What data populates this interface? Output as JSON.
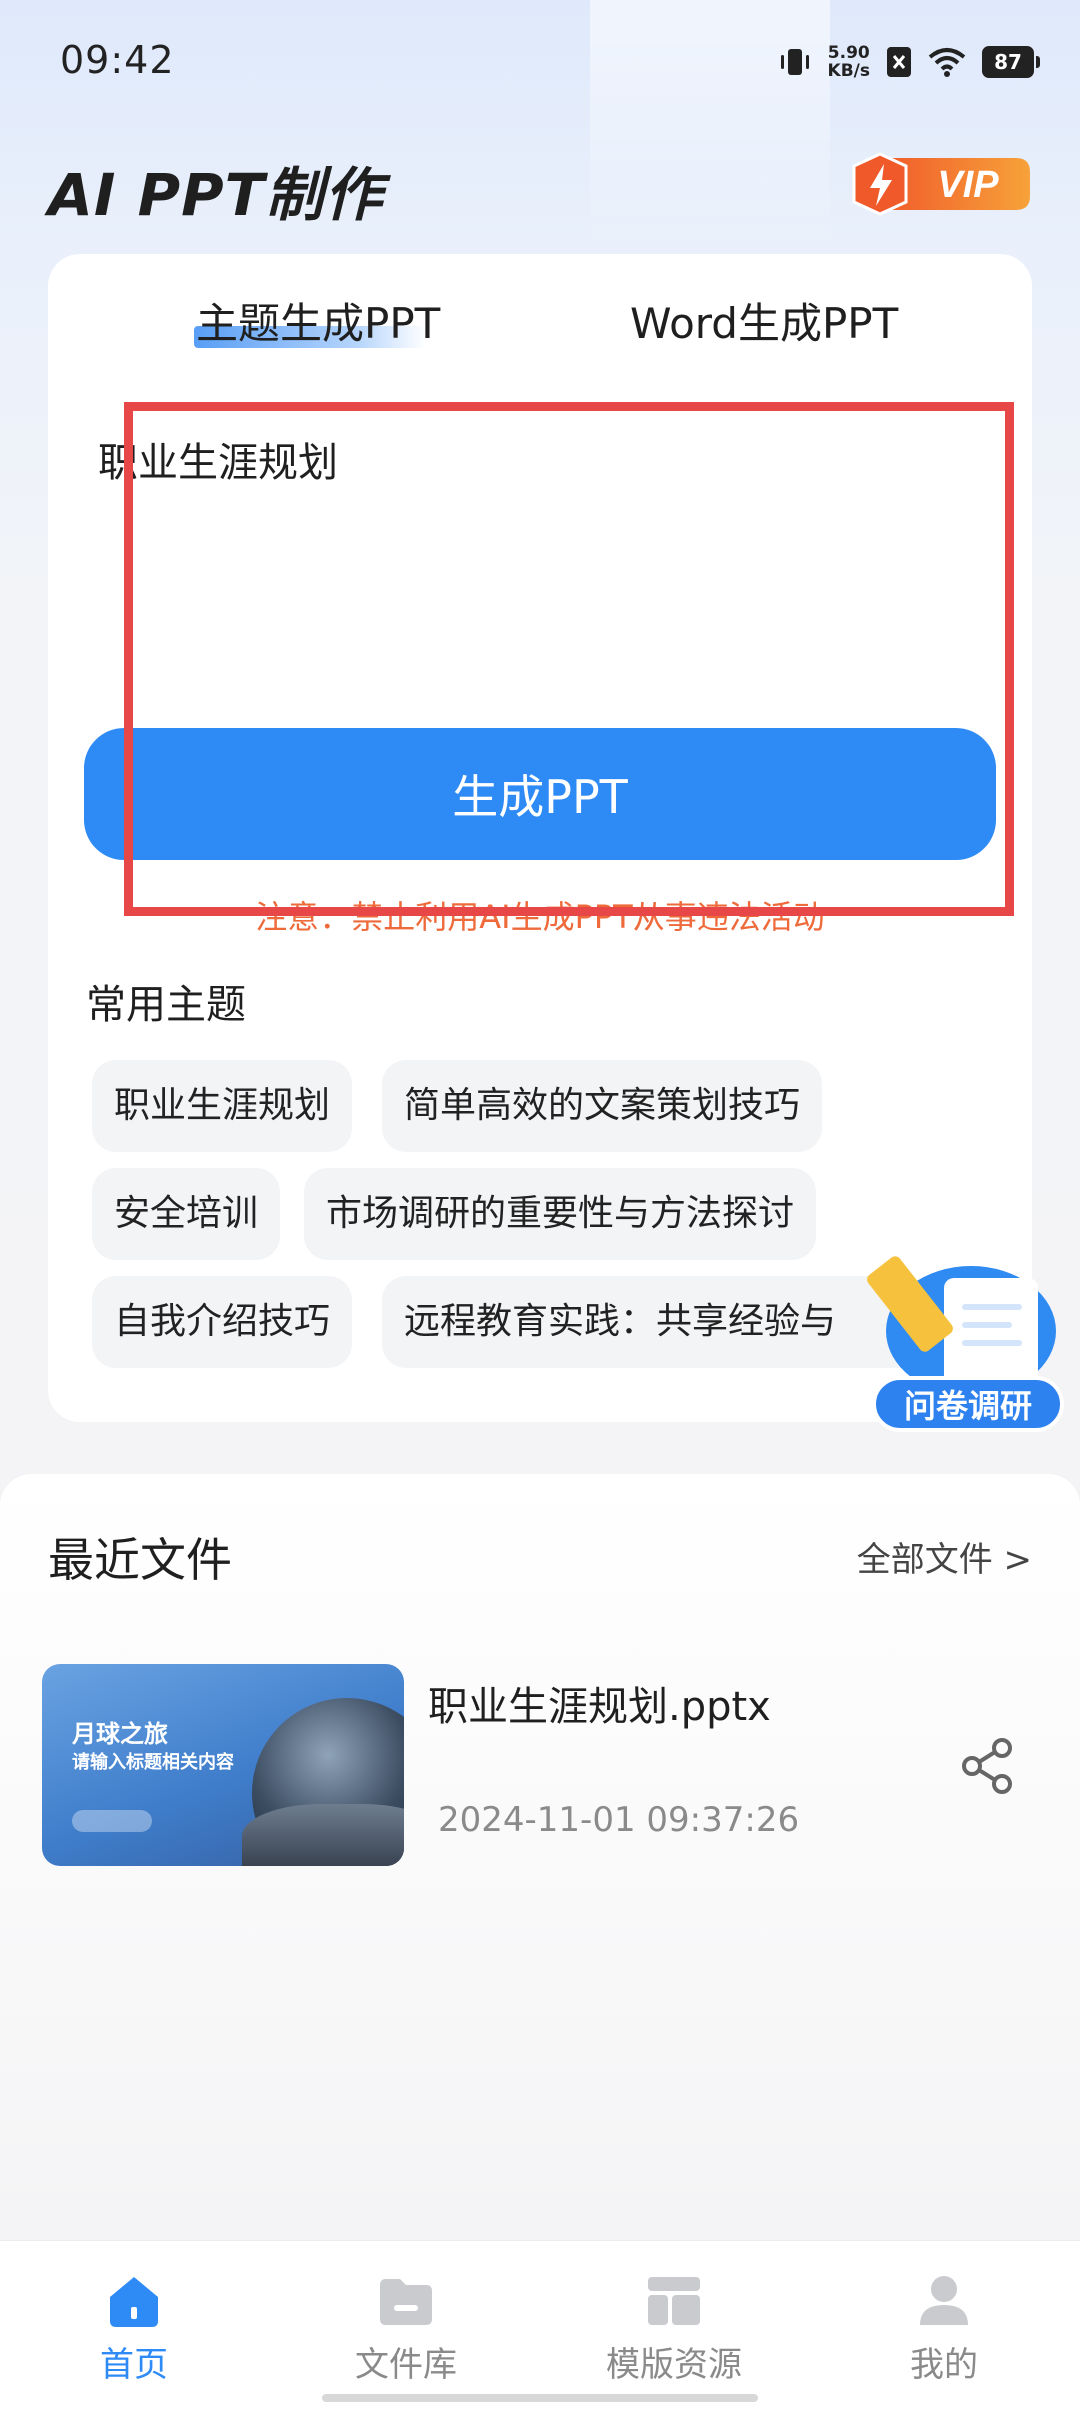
{
  "status_bar": {
    "time": "09:42",
    "speed_value": "5.90",
    "speed_unit": "KB/s",
    "battery": "87"
  },
  "header": {
    "title": "AI PPT制作",
    "vip_label": "VIP"
  },
  "generator": {
    "tabs": [
      "主题生成PPT",
      "Word生成PPT"
    ],
    "active_tab": 0,
    "topic_value": "职业生涯规划",
    "generate_label": "生成PPT",
    "warning": "注意：禁止利用AI生成PPT从事违法活动"
  },
  "common_topics": {
    "title": "常用主题",
    "items": [
      "职业生涯规划",
      "简单高效的文案策划技巧",
      "安全培训",
      "市场调研的重要性与方法探讨",
      "自我介绍技巧",
      "远程教育实践：共享经验与"
    ]
  },
  "survey": {
    "label": "问卷调研"
  },
  "recent": {
    "title": "最近文件",
    "all_label": "全部文件 >",
    "files": [
      {
        "name": "职业生涯规划.pptx",
        "date": "2024-11-01 09:37:26",
        "thumb_title": "月球之旅",
        "thumb_subtitle": "请输入标题相关内容"
      }
    ]
  },
  "nav": {
    "items": [
      "首页",
      "文件库",
      "模版资源",
      "我的"
    ],
    "active": 0
  },
  "colors": {
    "accent": "#2e8bf6",
    "warning": "#ef6a3a",
    "highlight": "#e84747",
    "vip": "#f2792a"
  }
}
